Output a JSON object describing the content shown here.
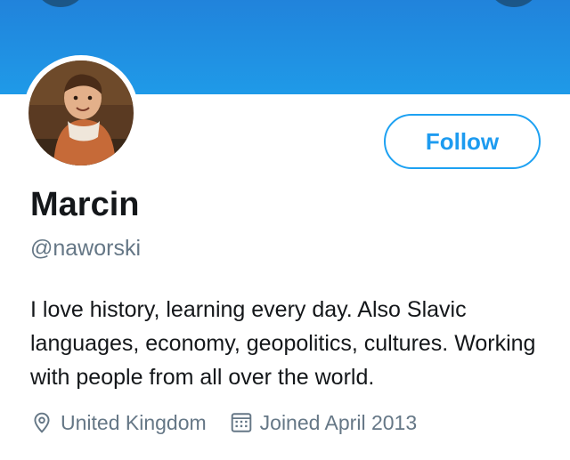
{
  "header": {
    "left_button_icon": "back-arrow-icon",
    "right_button_icon": "more-options-icon",
    "banner_color": "#1f9ae8"
  },
  "profile": {
    "avatar_icon": "profile-photo",
    "name": "Marcin",
    "handle": "@naworski",
    "bio": "I love history, learning every day. Also Slavic languages, economy, geopolitics, cultures. Working with people from all over the world.",
    "location_icon": "location-pin-icon",
    "location": "United Kingdom",
    "joined_icon": "calendar-icon",
    "joined": "Joined April 2013"
  },
  "actions": {
    "follow_label": "Follow",
    "accent_color": "#1da1f2"
  }
}
